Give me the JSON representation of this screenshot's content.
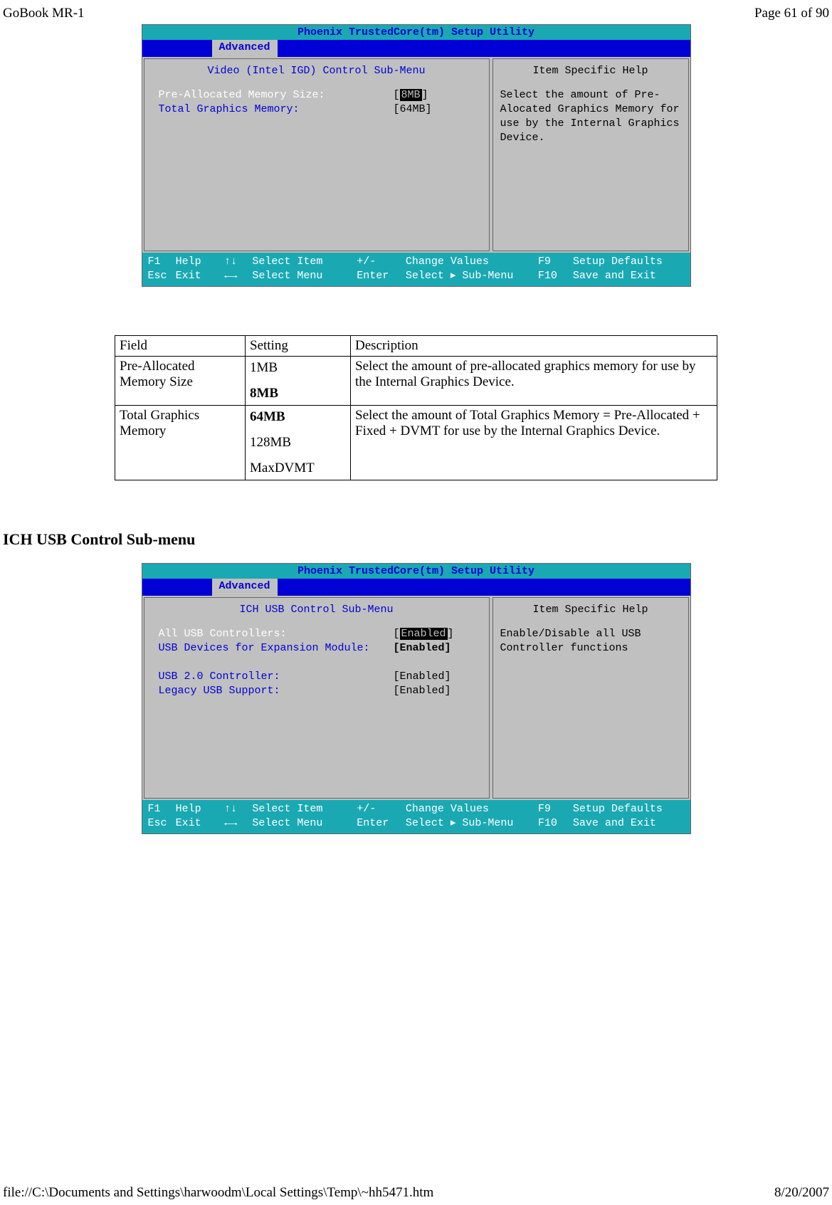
{
  "header": {
    "left": "GoBook MR-1",
    "right": "Page 61 of 90"
  },
  "footer": {
    "left": "file://C:\\Documents and Settings\\harwoodm\\Local Settings\\Temp\\~hh5471.htm",
    "right": "8/20/2007"
  },
  "bios1": {
    "title": "Phoenix TrustedCore(tm) Setup Utility",
    "tab": "Advanced",
    "panel_title": "Video (Intel IGD) Control Sub-Menu",
    "help_title": "Item Specific Help",
    "rows": [
      {
        "label": "Pre-Allocated Memory Size:",
        "value_bracket_open": "[",
        "value_sel": "8MB",
        "value_bracket_close": "]"
      },
      {
        "label": "Total Graphics Memory:",
        "value": "[64MB]"
      }
    ],
    "help_text": "Select the amount of Pre-Alocated Graphics Memory for use by the Internal Graphics Device.",
    "foot": {
      "r1": {
        "k1": "F1",
        "l1": "Help",
        "a1": "↑↓",
        "t1": "Select Item",
        "k2": "+/-",
        "t2": "Change Values",
        "k3": "F9",
        "t3": "Setup Defaults"
      },
      "r2": {
        "k1": "Esc",
        "l1": "Exit",
        "a1": "←→",
        "t1": "Select Menu",
        "k2": "Enter",
        "t2": "Select ▸ Sub-Menu",
        "k3": "F10",
        "t3": "Save and Exit"
      }
    }
  },
  "table": {
    "head": {
      "field": "Field",
      "setting": "Setting",
      "desc": "Description"
    },
    "rows": [
      {
        "field": "Pre-Allocated Memory Size",
        "settings": [
          {
            "t": "1MB",
            "b": false
          },
          {
            "t": "8MB",
            "b": true
          }
        ],
        "desc": "Select the amount of pre-allocated graphics memory for use by the Internal Graphics Device."
      },
      {
        "field": "Total Graphics Memory",
        "settings": [
          {
            "t": "64MB",
            "b": true
          },
          {
            "t": "128MB",
            "b": false
          },
          {
            "t": "MaxDVMT",
            "b": false
          }
        ],
        "desc": "Select the amount of Total Graphics Memory = Pre-Allocated + Fixed + DVMT for use by the Internal Graphics Device."
      }
    ]
  },
  "section_heading": "ICH USB Control Sub-menu",
  "bios2": {
    "title": "Phoenix TrustedCore(tm) Setup Utility",
    "tab": "Advanced",
    "panel_title": "ICH USB Control Sub-Menu",
    "help_title": "Item Specific Help",
    "rows": [
      {
        "label": "All USB Controllers:",
        "white": true,
        "value_bracket_open": "[",
        "value_sel": "Enabled",
        "value_bracket_close": "]"
      },
      {
        "label": "USB Devices for Expansion Module:",
        "blue": true,
        "value_bold": "[Enabled]"
      },
      {
        "gap": true
      },
      {
        "label": "USB 2.0 Controller:",
        "blue": true,
        "value": "[Enabled]"
      },
      {
        "label": "Legacy USB Support:",
        "blue": true,
        "value": "[Enabled]"
      }
    ],
    "help_text": "Enable/Disable all USB Controller functions",
    "foot": {
      "r1": {
        "k1": "F1",
        "l1": "Help",
        "a1": "↑↓",
        "t1": "Select Item",
        "k2": "+/-",
        "t2": "Change Values",
        "k3": "F9",
        "t3": "Setup Defaults"
      },
      "r2": {
        "k1": "Esc",
        "l1": "Exit",
        "a1": "←→",
        "t1": "Select Menu",
        "k2": "Enter",
        "t2": "Select ▸ Sub-Menu",
        "k3": "F10",
        "t3": "Save and Exit"
      }
    }
  }
}
